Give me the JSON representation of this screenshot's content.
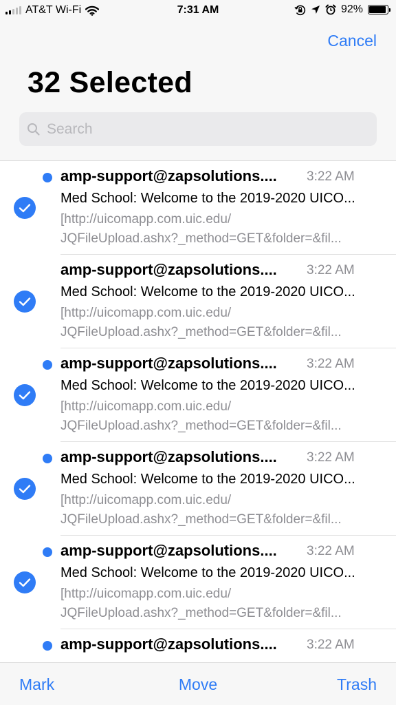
{
  "status_bar": {
    "carrier": "AT&T Wi-Fi",
    "time": "7:31 AM",
    "battery": "92%",
    "battery_fill": 0.92,
    "icons": [
      "signal-icon",
      "wifi-icon",
      "orientation-lock-icon",
      "location-icon",
      "alarm-icon",
      "battery-icon"
    ]
  },
  "header": {
    "cancel_label": "Cancel",
    "title": "32 Selected",
    "search_placeholder": "Search"
  },
  "messages": [
    {
      "unread": true,
      "sender": "amp-support@zapsolutions....",
      "time": "3:22 AM",
      "subject": "Med School: Welcome to the 2019-2020 UICO...",
      "preview_line1": "[http://uicomapp.com.uic.edu/",
      "preview_line2": "JQFileUpload.ashx?_method=GET&folder=&fil..."
    },
    {
      "unread": false,
      "sender": "amp-support@zapsolutions....",
      "time": "3:22 AM",
      "subject": "Med School: Welcome to the 2019-2020 UICO...",
      "preview_line1": "[http://uicomapp.com.uic.edu/",
      "preview_line2": "JQFileUpload.ashx?_method=GET&folder=&fil..."
    },
    {
      "unread": true,
      "sender": "amp-support@zapsolutions....",
      "time": "3:22 AM",
      "subject": "Med School: Welcome to the 2019-2020 UICO...",
      "preview_line1": "[http://uicomapp.com.uic.edu/",
      "preview_line2": "JQFileUpload.ashx?_method=GET&folder=&fil..."
    },
    {
      "unread": true,
      "sender": "amp-support@zapsolutions....",
      "time": "3:22 AM",
      "subject": "Med School: Welcome to the 2019-2020 UICO...",
      "preview_line1": "[http://uicomapp.com.uic.edu/",
      "preview_line2": "JQFileUpload.ashx?_method=GET&folder=&fil..."
    },
    {
      "unread": true,
      "sender": "amp-support@zapsolutions....",
      "time": "3:22 AM",
      "subject": "Med School: Welcome to the 2019-2020 UICO...",
      "preview_line1": "[http://uicomapp.com.uic.edu/",
      "preview_line2": "JQFileUpload.ashx?_method=GET&folder=&fil..."
    },
    {
      "unread": true,
      "sender": "amp-support@zapsolutions....",
      "time": "3:22 AM",
      "subject": "",
      "preview_line1": "",
      "preview_line2": ""
    }
  ],
  "toolbar": {
    "mark_label": "Mark",
    "move_label": "Move",
    "trash_label": "Trash"
  },
  "colors": {
    "accent": "#2f7cf6",
    "secondary_text": "#8e8e93",
    "bar_background": "#f7f7f7"
  }
}
